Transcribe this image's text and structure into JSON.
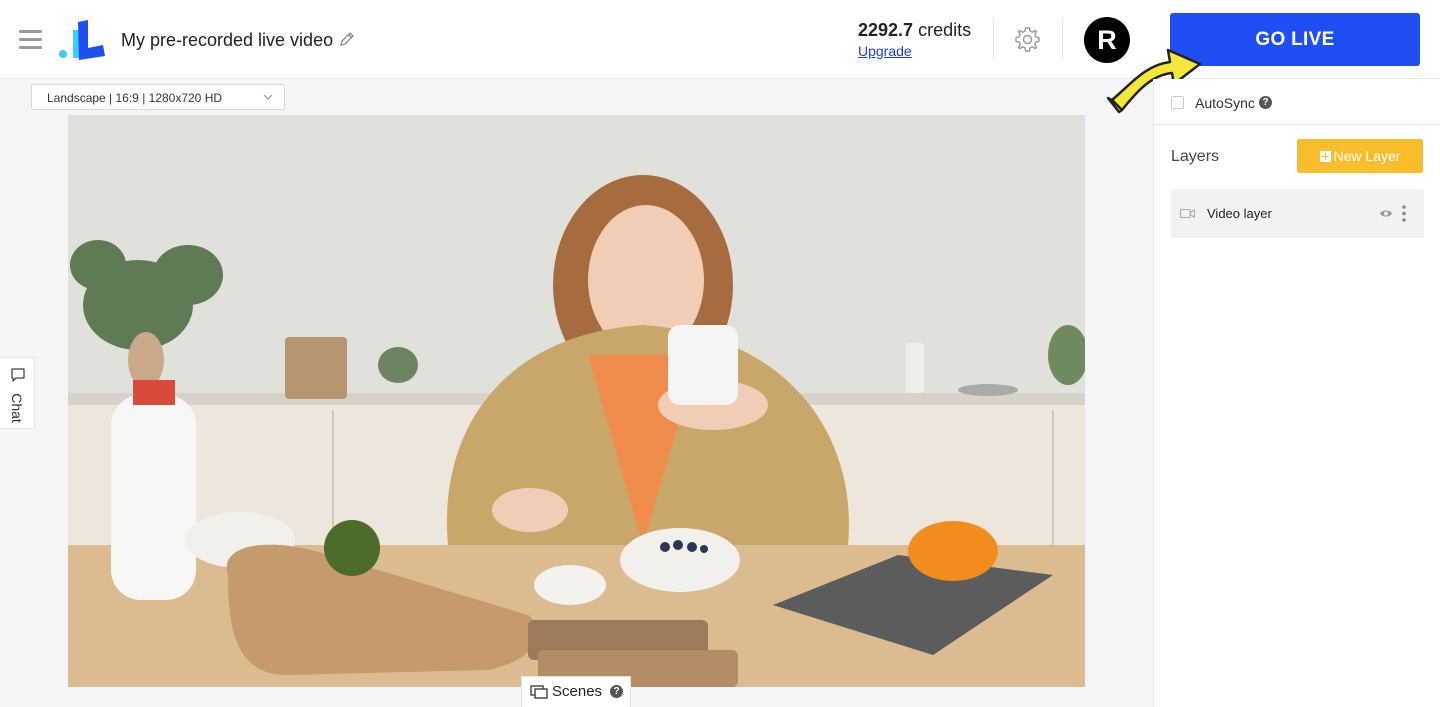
{
  "header": {
    "project_title": "My pre-recorded live video",
    "credits_amount": "2292.7",
    "credits_unit": "credits",
    "upgrade_label": "Upgrade",
    "avatar_initial": "R",
    "go_live_label": "GO LIVE"
  },
  "stage": {
    "format_value": "Landscape | 16:9 | 1280x720 HD",
    "chat_label": "Chat",
    "scenes_label": "Scenes",
    "scenes_help": "?"
  },
  "right_panel": {
    "autosync_label": "AutoSync",
    "autosync_checked": false,
    "autosync_help": "?",
    "layers_title": "Layers",
    "new_layer_label": "New Layer",
    "layers": [
      {
        "name": "Video layer",
        "icon": "camera-icon"
      }
    ]
  },
  "colors": {
    "accent_blue": "#1f4ef5",
    "new_layer_yellow": "#f7bd2c",
    "arrow_yellow": "#f5e63a"
  }
}
